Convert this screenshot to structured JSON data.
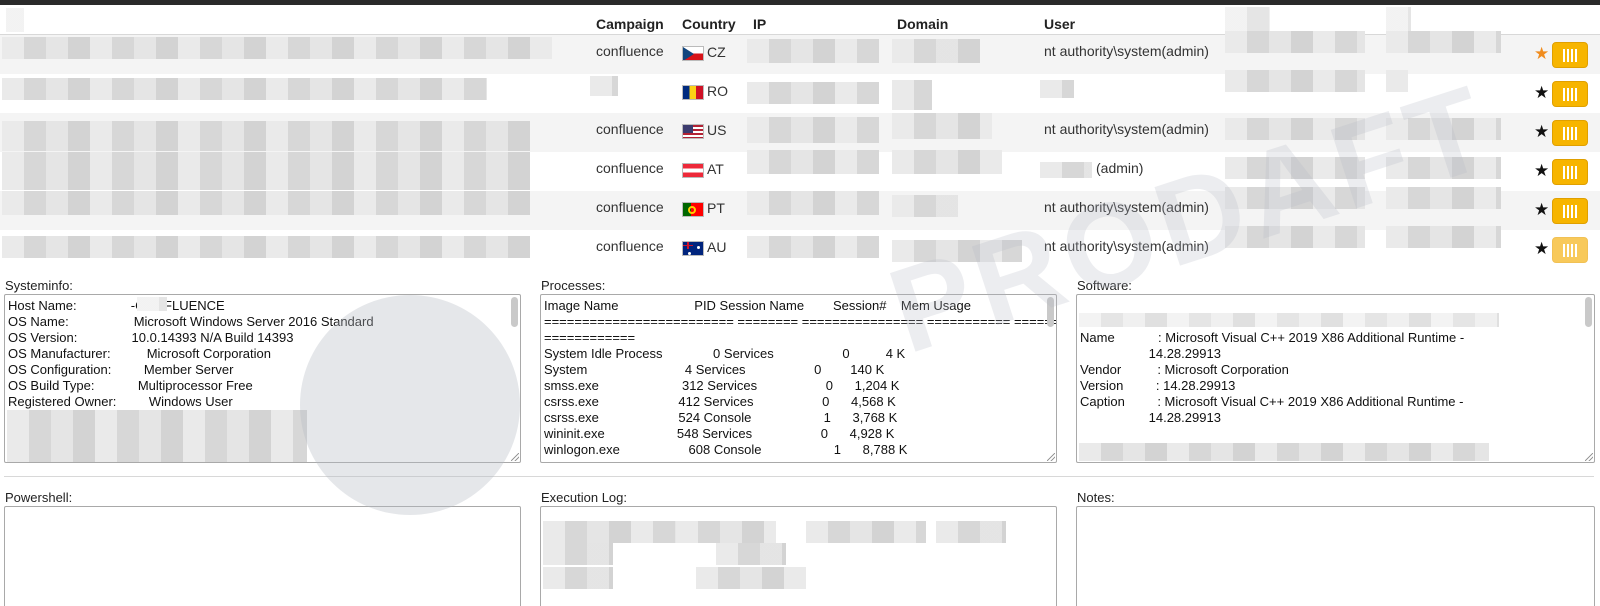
{
  "table": {
    "headers": {
      "campaign": "Campaign",
      "country": "Country",
      "ip": "IP",
      "domain": "Domain",
      "user": "User"
    },
    "rows": [
      {
        "campaign": "confluence",
        "country": "CZ",
        "user": "nt authority\\system(admin)",
        "starred": true
      },
      {
        "campaign": "",
        "country": "RO",
        "user": "",
        "starred": false
      },
      {
        "campaign": "confluence",
        "country": "US",
        "user": "nt authority\\system(admin)",
        "starred": false
      },
      {
        "campaign": "confluence",
        "country": "AT",
        "user": "(admin)",
        "starred": false
      },
      {
        "campaign": "confluence",
        "country": "PT",
        "user": "nt authority\\system(admin)",
        "starred": false
      },
      {
        "campaign": "confluence",
        "country": "AU",
        "user": "nt authority\\system(admin)",
        "starred": false
      }
    ]
  },
  "panels": {
    "systeminfo": {
      "label": "Systeminfo:",
      "text": "Host Name:               -CONFLUENCE\nOS Name:                  Microsoft Windows Server 2016 Standard\nOS Version:               10.0.14393 N/A Build 14393\nOS Manufacturer:          Microsoft Corporation\nOS Configuration:         Member Server\nOS Build Type:            Multiprocessor Free\nRegistered Owner:         Windows User"
    },
    "processes": {
      "label": "Processes:",
      "text": "Image Name                     PID Session Name        Session#    Mem Usage\n========================= ======== ================ =========== ============\n============\nSystem Idle Process              0 Services                   0          4 K\nSystem                           4 Services                   0        140 K\nsmss.exe                       312 Services                   0      1,204 K\ncsrss.exe                      412 Services                   0      4,568 K\ncsrss.exe                      524 Console                    1      3,768 K\nwininit.exe                    548 Services                   0      4,928 K\nwinlogon.exe                   608 Console                    1      8,788 K"
    },
    "software": {
      "label": "Software:",
      "text": "\n\nName            : Microsoft Visual C++ 2019 X86 Additional Runtime -\n                   14.28.29913\nVendor          : Microsoft Corporation\nVersion         : 14.28.29913\nCaption         : Microsoft Visual C++ 2019 X86 Additional Runtime -\n                   14.28.29913"
    },
    "powershell": {
      "label": "Powershell:"
    },
    "execution_log": {
      "label": "Execution Log:"
    },
    "notes": {
      "label": "Notes:"
    }
  },
  "watermark": "PRODAFT",
  "colors": {
    "accent": "#f7b500",
    "star_active": "#f08c1e",
    "row_alt": "#f4f4f4"
  }
}
